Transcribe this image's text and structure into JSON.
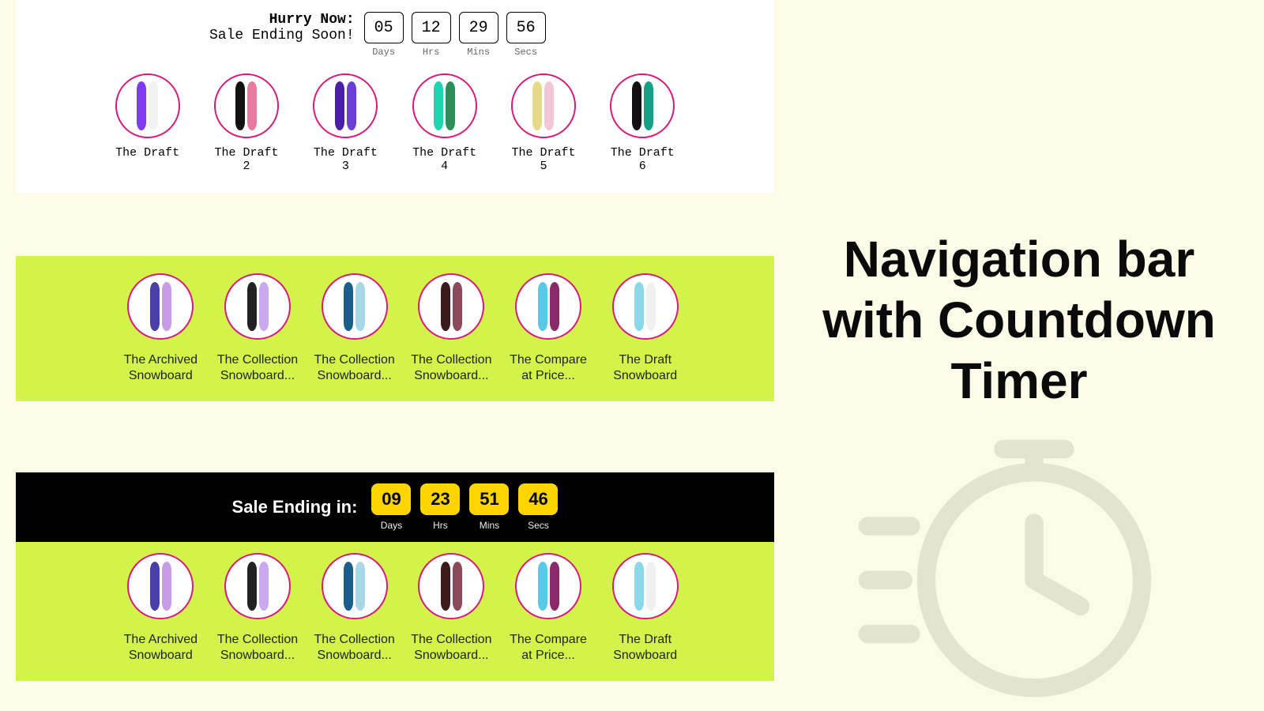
{
  "panel1": {
    "hurry_title": "Hurry Now:",
    "hurry_subtitle": "Sale Ending Soon!",
    "countdown": {
      "days": "05",
      "hrs": "12",
      "mins": "29",
      "secs": "56",
      "l_days": "Days",
      "l_hrs": "Hrs",
      "l_mins": "Mins",
      "l_secs": "Secs"
    },
    "items": [
      {
        "label": "The Draft",
        "colors": [
          "#7d3bed",
          "#f2f2f2"
        ]
      },
      {
        "label": "The Draft 2",
        "colors": [
          "#111",
          "#e87aa2"
        ]
      },
      {
        "label": "The Draft 3",
        "colors": [
          "#4a1fa8",
          "#6a3fd8"
        ]
      },
      {
        "label": "The Draft 4",
        "colors": [
          "#1fd4b0",
          "#2a8f5a"
        ]
      },
      {
        "label": "The Draft 5",
        "colors": [
          "#e8d98a",
          "#f2c6d6"
        ]
      },
      {
        "label": "The Draft 6",
        "colors": [
          "#111",
          "#16a085"
        ]
      }
    ]
  },
  "panel2": {
    "items": [
      {
        "label": "The Archived Snowboard",
        "colors": [
          "#4a3fa8",
          "#c79be8"
        ]
      },
      {
        "label": "The Collection Snowboard...",
        "colors": [
          "#222",
          "#c9a8f0"
        ]
      },
      {
        "label": "The Collection Snowboard...",
        "colors": [
          "#1a5f8a",
          "#a8d8e8"
        ]
      },
      {
        "label": "The Collection Snowboard...",
        "colors": [
          "#3a1a1a",
          "#8a4a5a"
        ]
      },
      {
        "label": "The Compare at Price...",
        "colors": [
          "#5ac8e8",
          "#8a2a6a"
        ]
      },
      {
        "label": "The Draft Snowboard",
        "colors": [
          "#8ad8e8",
          "#f0f0f0"
        ]
      }
    ]
  },
  "panel3": {
    "title": "Sale Ending in:",
    "countdown": {
      "days": "09",
      "hrs": "23",
      "mins": "51",
      "secs": "46",
      "l_days": "Days",
      "l_hrs": "Hrs",
      "l_mins": "Mins",
      "l_secs": "Secs"
    },
    "items": [
      {
        "label": "The Archived Snowboard",
        "colors": [
          "#4a3fa8",
          "#c79be8"
        ]
      },
      {
        "label": "The Collection Snowboard...",
        "colors": [
          "#222",
          "#c9a8f0"
        ]
      },
      {
        "label": "The Collection Snowboard...",
        "colors": [
          "#1a5f8a",
          "#a8d8e8"
        ]
      },
      {
        "label": "The Collection Snowboard...",
        "colors": [
          "#3a1a1a",
          "#8a4a5a"
        ]
      },
      {
        "label": "The Compare at Price...",
        "colors": [
          "#5ac8e8",
          "#8a2a6a"
        ]
      },
      {
        "label": "The Draft Snowboard",
        "colors": [
          "#8ad8e8",
          "#f0f0f0"
        ]
      }
    ]
  },
  "page_title": "Navigation bar with Countdown Timer"
}
